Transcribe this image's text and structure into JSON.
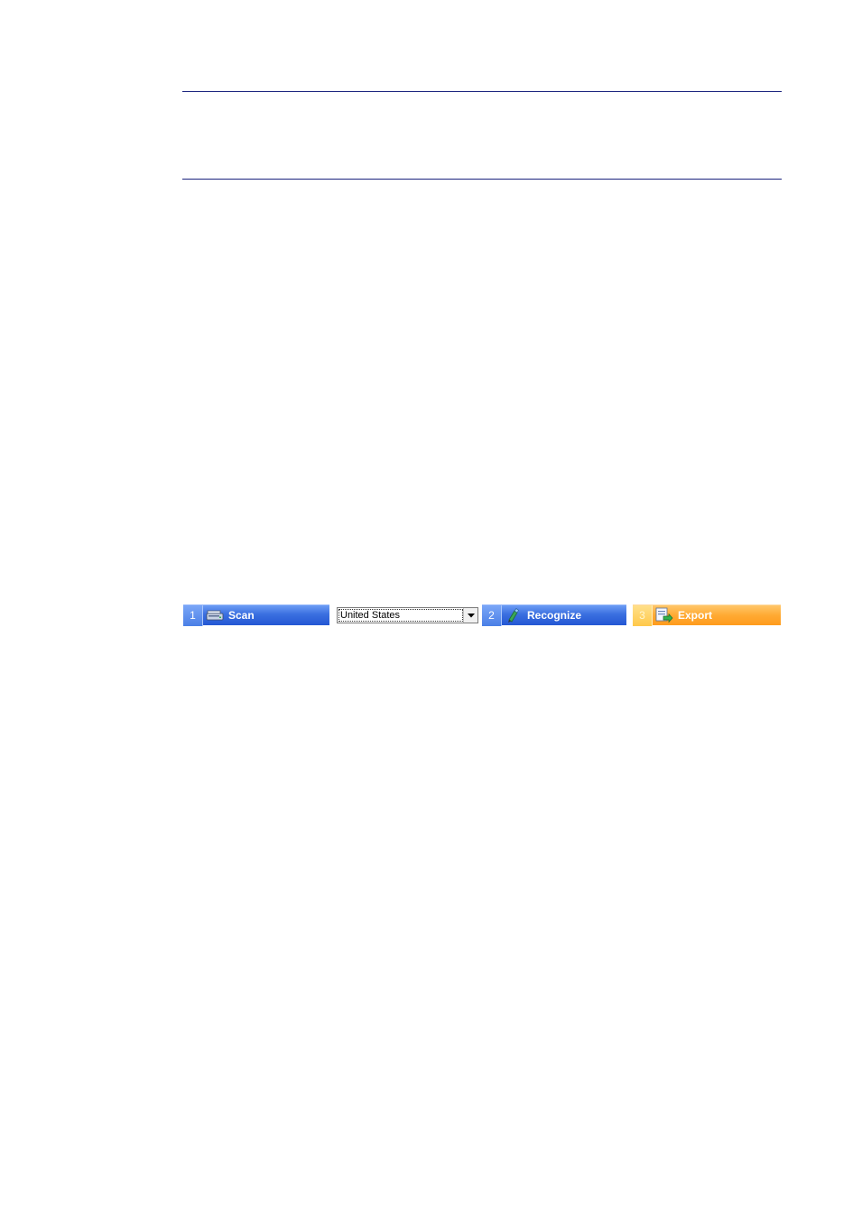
{
  "toolbar": {
    "scan": {
      "number": "1",
      "label": "Scan",
      "icon": "scanner-icon"
    },
    "language": {
      "selected": "United States",
      "icon": "chevron-down-icon"
    },
    "recognize": {
      "number": "2",
      "label": "Recognize",
      "icon": "recognize-icon"
    },
    "export": {
      "number": "3",
      "label": "Export",
      "icon": "export-icon"
    }
  },
  "colors": {
    "rule": "#1a237e",
    "step_blue": "#3a6fe0",
    "step_orange": "#ffaa33"
  }
}
